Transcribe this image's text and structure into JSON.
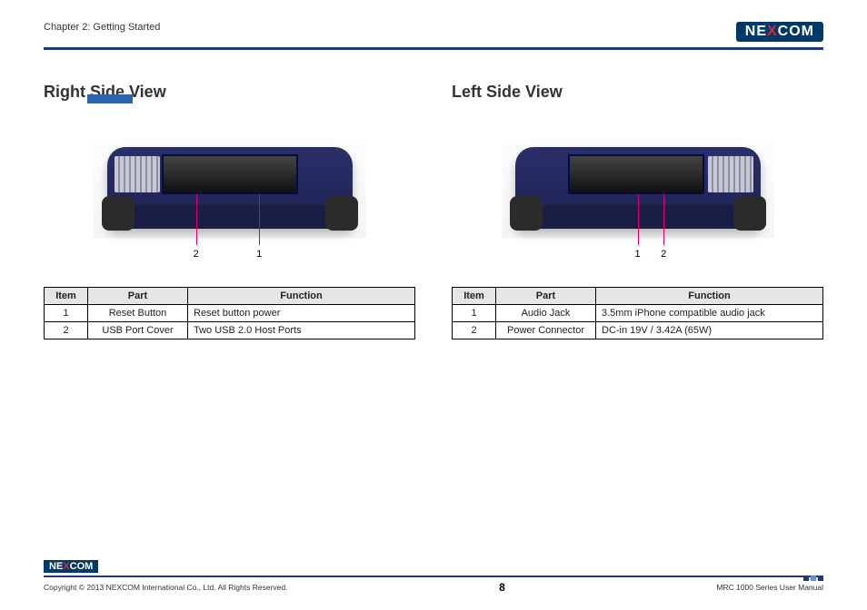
{
  "header": {
    "chapter": "Chapter 2: Getting Started",
    "logo_left": "NE",
    "logo_mid": "X",
    "logo_right": "COM"
  },
  "sections": {
    "right": {
      "title": "Right Side View",
      "callouts": [
        "2",
        "1"
      ],
      "table": {
        "headers": [
          "Item",
          "Part",
          "Function"
        ],
        "rows": [
          {
            "item": "1",
            "part": "Reset Button",
            "func": "Reset button power"
          },
          {
            "item": "2",
            "part": "USB Port Cover",
            "func": "Two USB 2.0 Host Ports"
          }
        ]
      }
    },
    "left": {
      "title": "Left Side View",
      "callouts": [
        "1",
        "2"
      ],
      "table": {
        "headers": [
          "Item",
          "Part",
          "Function"
        ],
        "rows": [
          {
            "item": "1",
            "part": "Audio Jack",
            "func": "3.5mm iPhone compatible audio jack"
          },
          {
            "item": "2",
            "part": "Power Connector",
            "func": "DC-in 19V / 3.42A (65W)"
          }
        ]
      }
    }
  },
  "footer": {
    "copyright": "Copyright © 2013 NEXCOM International Co., Ltd. All Rights Reserved.",
    "page": "8",
    "manual": "MRC 1000 Series User Manual"
  }
}
